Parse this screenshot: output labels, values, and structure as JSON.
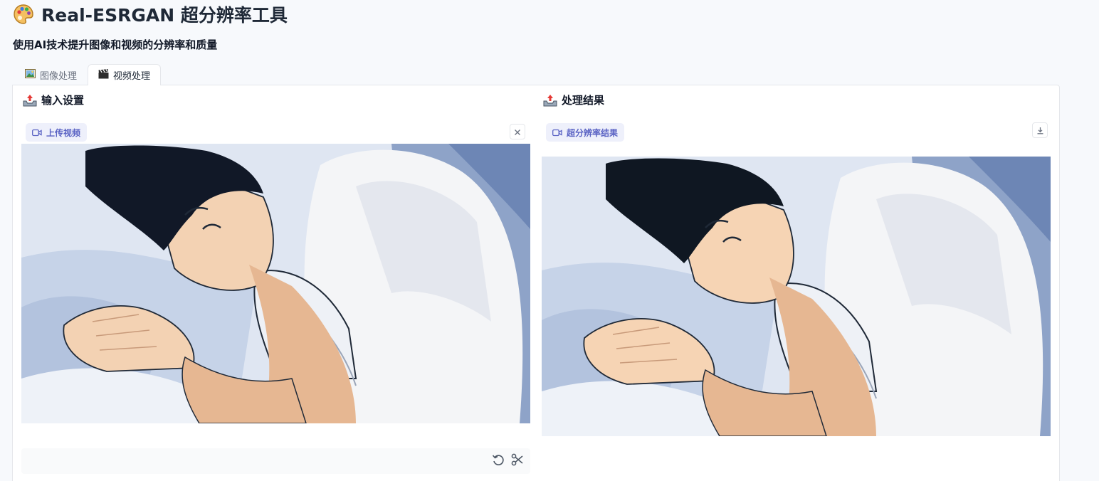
{
  "app": {
    "title": "Real-ESRGAN 超分辨率工具",
    "subtitle": "使用AI技术提升图像和视频的分辨率和质量",
    "title_icon": "palette-icon"
  },
  "tabs": [
    {
      "label": "图像处理",
      "icon": "picture-icon",
      "active": false
    },
    {
      "label": "视频处理",
      "icon": "clapper-icon",
      "active": true
    }
  ],
  "input_panel": {
    "heading": "输入设置",
    "heading_icon": "outbox-tray-icon",
    "upload_label": "上传视频",
    "upload_icon": "video-camera-icon",
    "clear_icon": "close-icon",
    "tools": [
      "undo-icon",
      "scissors-icon"
    ]
  },
  "output_panel": {
    "heading": "处理结果",
    "heading_icon": "outbox-tray-icon",
    "result_label": "超分辨率结果",
    "result_icon": "video-camera-icon",
    "download_icon": "download-icon"
  },
  "colors": {
    "accent": "#5a63c4",
    "chip_bg": "#eef0fb",
    "border": "#e5e7eb",
    "page_bg": "#f7f9fc"
  }
}
